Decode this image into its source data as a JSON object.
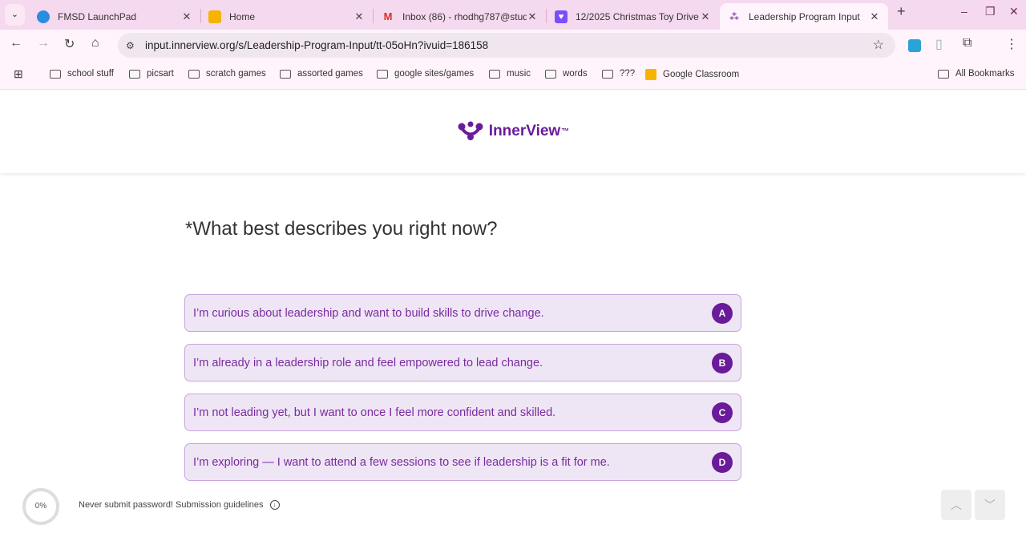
{
  "browser": {
    "tabs": [
      {
        "title": "FMSD LaunchPad",
        "icon": "cloud-icon",
        "color": "#2a8ee0"
      },
      {
        "title": "Home",
        "icon": "classroom-icon",
        "color": "#f5b400"
      },
      {
        "title": "Inbox (86) - rhodhg787@stud",
        "icon": "gmail-icon",
        "color": "#d93025"
      },
      {
        "title": "12/2025 Christmas Toy Drive",
        "icon": "heart-chat-icon",
        "color": "#7c4dff"
      },
      {
        "title": "Leadership Program Input",
        "icon": "innerview-icon",
        "color": "#6a1b9a",
        "active": true
      }
    ],
    "url": "input.innerview.org/s/Leadership-Program-Input/tt-05oHn?ivuid=186158",
    "bookmarks": [
      "school stuff",
      "picsart",
      "scratch games",
      "assorted games",
      "google sites/games",
      "music",
      "words",
      "???",
      "Google Classroom"
    ],
    "all_bookmarks": "All Bookmarks"
  },
  "page": {
    "logo": "InnerView",
    "logo_tm": "™",
    "question": "*What best describes you right now?",
    "options": [
      {
        "text": "I’m curious about leadership and want to build skills to drive change.",
        "key": "A"
      },
      {
        "text": "I’m already in a leadership role and feel empowered to lead change.",
        "key": "B"
      },
      {
        "text": "I’m not leading yet, but I want to once I feel more confident and skilled.",
        "key": "C"
      },
      {
        "text": "I’m exploring — I want to attend a few sessions to see if leadership is a fit for me.",
        "key": "D"
      }
    ],
    "progress": "0%",
    "footer_text": "Never submit password! Submission guidelines",
    "accent": "#6a1b9a"
  }
}
